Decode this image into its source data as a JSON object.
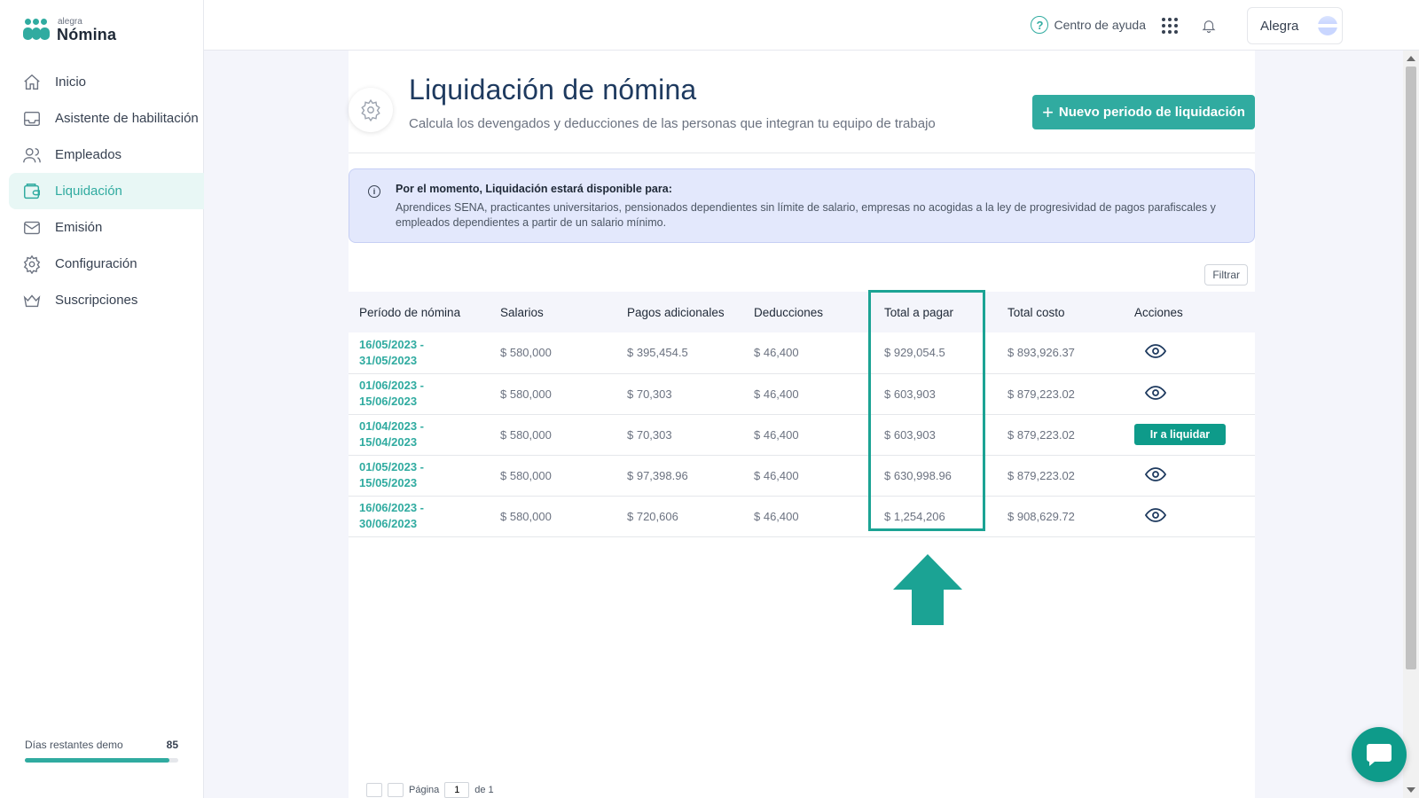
{
  "app": {
    "logo_small": "alegra",
    "logo_big": "Nómina"
  },
  "sidebar": {
    "items": [
      {
        "label": "Inicio",
        "icon": "home-icon"
      },
      {
        "label": "Asistente de habilitación",
        "icon": "inbox-icon"
      },
      {
        "label": "Empleados",
        "icon": "users-icon"
      },
      {
        "label": "Liquidación",
        "icon": "wallet-icon",
        "active": true
      },
      {
        "label": "Emisión",
        "icon": "mail-icon"
      },
      {
        "label": "Configuración",
        "icon": "gear-icon"
      },
      {
        "label": "Suscripciones",
        "icon": "crown-icon"
      }
    ],
    "demo_label": "Días restantes demo",
    "demo_days": "85",
    "demo_progress": 0.94
  },
  "topbar": {
    "help_label": "Centro de ayuda",
    "user_name": "Alegra"
  },
  "header": {
    "title": "Liquidación de nómina",
    "subtitle": "Calcula los devengados y deducciones de las personas que integran tu equipo de trabajo",
    "new_button": "Nuevo periodo de liquidación"
  },
  "info": {
    "title": "Por el momento, Liquidación estará disponible para:",
    "text": "Aprendices SENA, practicantes universitarios, pensionados dependientes sin límite de salario, empresas no acogidas a la ley de progresividad de pagos parafiscales y empleados dependientes a partir de un salario mínimo."
  },
  "filter_label": "Filtrar",
  "table": {
    "columns": [
      "Período de nómina",
      "Salarios",
      "Pagos adicionales",
      "Deducciones",
      "Total a pagar",
      "Total costo",
      "Acciones"
    ],
    "rows": [
      {
        "period_start": "16/05/2023 -",
        "period_end": "31/05/2023",
        "salarios": "$ 580,000",
        "pagos": "$ 395,454.5",
        "deducciones": "$ 46,400",
        "total": "$ 929,054.5",
        "costo": "$ 893,926.37",
        "action": "view"
      },
      {
        "period_start": "01/06/2023 -",
        "period_end": "15/06/2023",
        "salarios": "$ 580,000",
        "pagos": "$ 70,303",
        "deducciones": "$ 46,400",
        "total": "$ 603,903",
        "costo": "$ 879,223.02",
        "action": "view"
      },
      {
        "period_start": "01/04/2023 -",
        "period_end": "15/04/2023",
        "salarios": "$ 580,000",
        "pagos": "$ 70,303",
        "deducciones": "$ 46,400",
        "total": "$ 603,903",
        "costo": "$ 879,223.02",
        "action": "liquidar"
      },
      {
        "period_start": "01/05/2023 -",
        "period_end": "15/05/2023",
        "salarios": "$ 580,000",
        "pagos": "$ 97,398.96",
        "deducciones": "$ 46,400",
        "total": "$ 630,998.96",
        "costo": "$ 879,223.02",
        "action": "view"
      },
      {
        "period_start": "16/06/2023 -",
        "period_end": "30/06/2023",
        "salarios": "$ 580,000",
        "pagos": "$ 720,606",
        "deducciones": "$ 46,400",
        "total": "$ 1,254,206",
        "costo": "$ 908,629.72",
        "action": "view"
      }
    ],
    "liquidar_label": "Ir a liquidar"
  },
  "pagination": {
    "page_label": "Página",
    "page_value": "1",
    "of_label": "de 1"
  },
  "colors": {
    "accent": "#30aba0",
    "highlight": "#1ba394",
    "info_bg": "#e3e8fc"
  }
}
